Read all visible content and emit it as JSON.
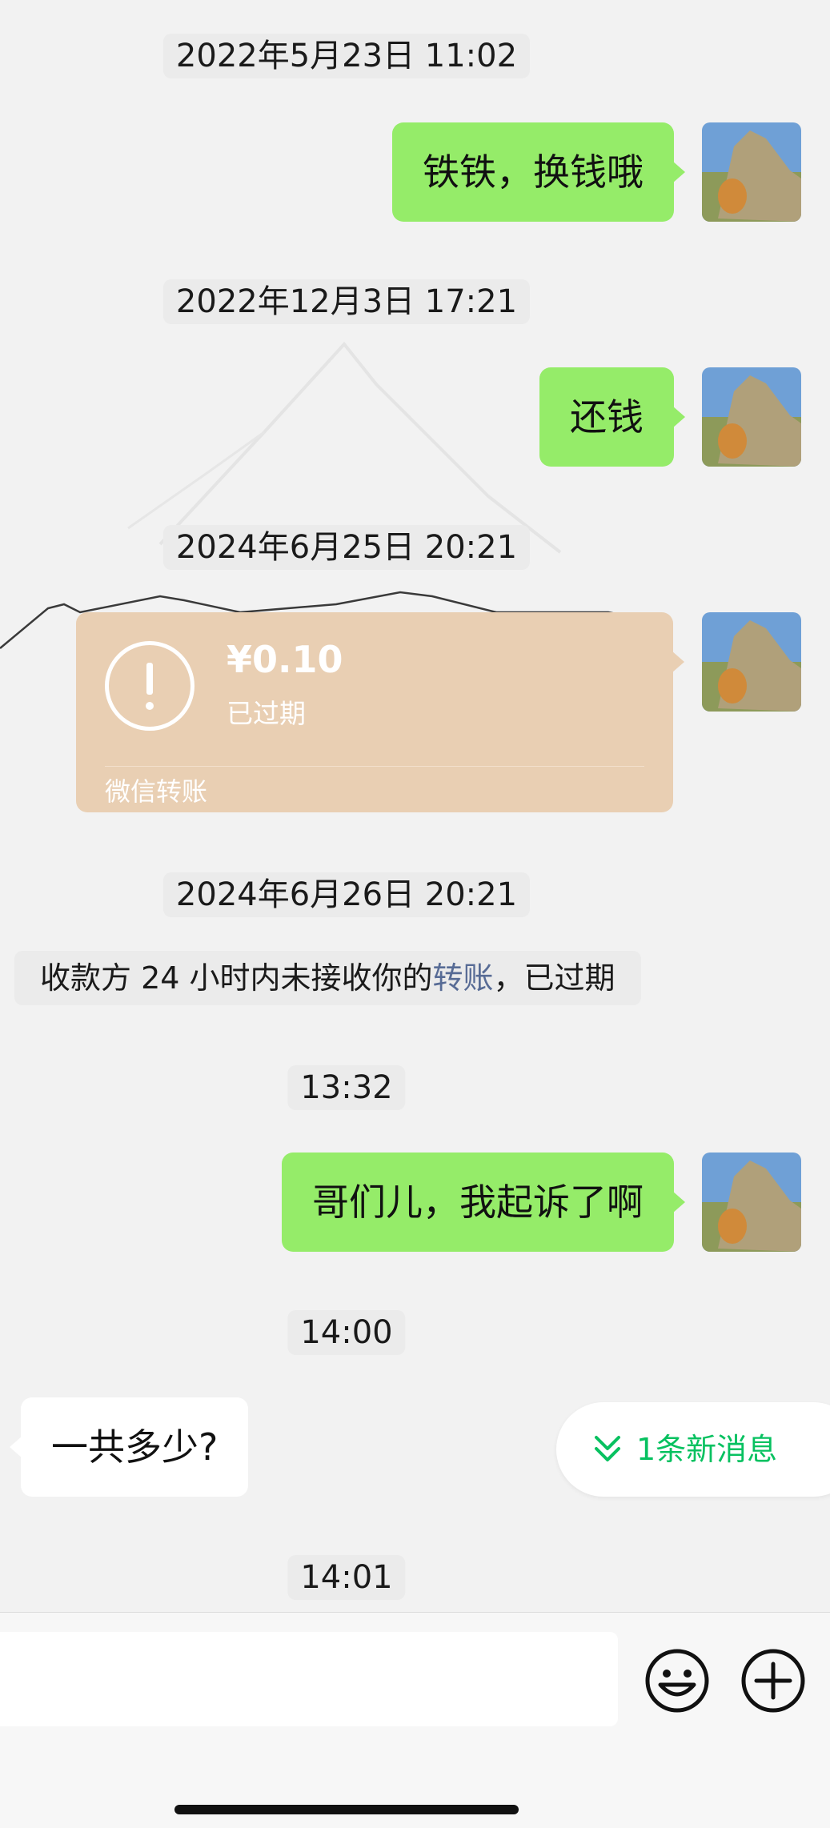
{
  "messages": {
    "ts1": "2022年5月23日 11:02",
    "msg1": "铁铁，换钱哦",
    "ts2": "2022年12月3日 17:21",
    "msg2": "还钱",
    "ts3": "2024年6月25日 20:21",
    "transfer": {
      "amount": "¥0.10",
      "status": "已过期",
      "label": "微信转账",
      "card_color": "#e9cfb3"
    },
    "ts4": "2024年6月26日 20:21",
    "system": {
      "prefix": "收款方 24 小时内未接收你的",
      "link": "转账",
      "suffix": "，已过期"
    },
    "ts5": "13:32",
    "msg3": "哥们儿，我起诉了啊",
    "ts6": "14:00",
    "msg4": "一共多少?",
    "ts7": "14:01"
  },
  "new_message_pill": {
    "label": "1条新消息",
    "icon": "double-chevron-down-icon",
    "color": "#07c160"
  },
  "composer": {
    "emoji_icon": "emoji-icon",
    "plus_icon": "plus-icon"
  },
  "colors": {
    "sent_bubble": "#95ec69",
    "received_bubble": "#ffffff",
    "background": "#f2f2f2",
    "link": "#576b95"
  }
}
